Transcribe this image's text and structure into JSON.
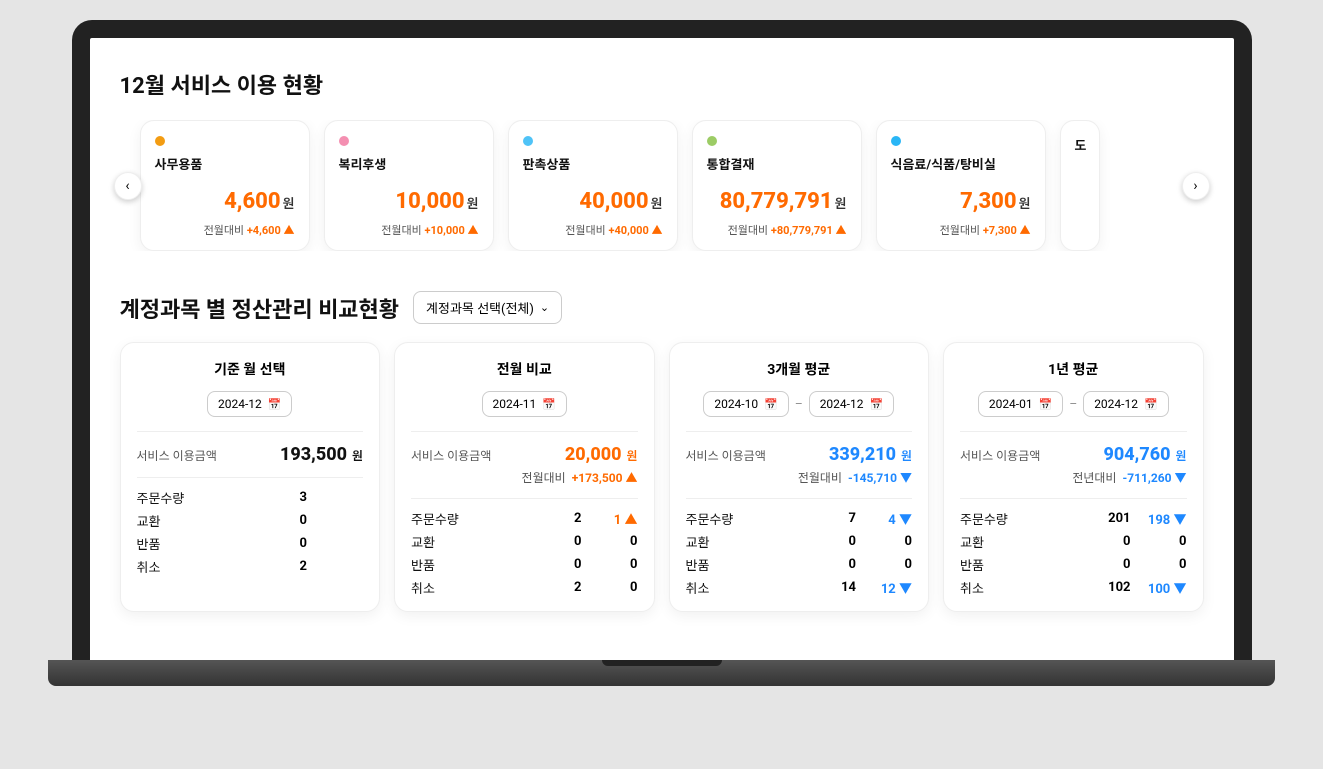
{
  "section1": {
    "title": "12월 서비스 이용 현황",
    "cards": [
      {
        "dot": "#f39c12",
        "name": "사무용품",
        "amount": "4,600",
        "won": "원",
        "delta_label": "전월대비",
        "delta": "+4,600"
      },
      {
        "dot": "#f48fb1",
        "name": "복리후생",
        "amount": "10,000",
        "won": "원",
        "delta_label": "전월대비",
        "delta": "+10,000"
      },
      {
        "dot": "#4fc3f7",
        "name": "판촉상품",
        "amount": "40,000",
        "won": "원",
        "delta_label": "전월대비",
        "delta": "+40,000"
      },
      {
        "dot": "#9ccc65",
        "name": "통합결재",
        "amount": "80,779,791",
        "won": "원",
        "delta_label": "전월대비",
        "delta": "+80,779,791"
      },
      {
        "dot": "#29b6f6",
        "name": "식음료/식품/탕비실",
        "amount": "7,300",
        "won": "원",
        "delta_label": "전월대비",
        "delta": "+7,300"
      }
    ],
    "peek_name": "도"
  },
  "section2": {
    "title": "계정과목 별 정산관리 비교현황",
    "select_label": "계정과목 선택(전체)",
    "cards": [
      {
        "title": "기준 월 선택",
        "dates": [
          "2024-12"
        ],
        "amount_label": "서비스 이용금액",
        "amount": "193,500",
        "won": "원",
        "amount_color": "black",
        "delta": null,
        "stats": [
          {
            "k": "주문수량",
            "v1": "3",
            "v2": null
          },
          {
            "k": "교환",
            "v1": "0",
            "v2": null
          },
          {
            "k": "반품",
            "v1": "0",
            "v2": null
          },
          {
            "k": "취소",
            "v1": "2",
            "v2": null
          }
        ]
      },
      {
        "title": "전월 비교",
        "dates": [
          "2024-11"
        ],
        "amount_label": "서비스 이용금액",
        "amount": "20,000",
        "won": "원",
        "amount_color": "orange",
        "delta": {
          "label": "전월대비",
          "value": "+173,500",
          "dir": "up",
          "color": "orange"
        },
        "stats": [
          {
            "k": "주문수량",
            "v1": "2",
            "v2": "1",
            "dir": "up",
            "color": "orange"
          },
          {
            "k": "교환",
            "v1": "0",
            "v2": "0"
          },
          {
            "k": "반품",
            "v1": "0",
            "v2": "0"
          },
          {
            "k": "취소",
            "v1": "2",
            "v2": "0"
          }
        ]
      },
      {
        "title": "3개월 평균",
        "dates": [
          "2024-10",
          "2024-12"
        ],
        "amount_label": "서비스 이용금액",
        "amount": "339,210",
        "won": "원",
        "amount_color": "blue",
        "delta": {
          "label": "전월대비",
          "value": "-145,710",
          "dir": "down",
          "color": "blue"
        },
        "stats": [
          {
            "k": "주문수량",
            "v1": "7",
            "v2": "4",
            "dir": "down",
            "color": "blue"
          },
          {
            "k": "교환",
            "v1": "0",
            "v2": "0"
          },
          {
            "k": "반품",
            "v1": "0",
            "v2": "0"
          },
          {
            "k": "취소",
            "v1": "14",
            "v2": "12",
            "dir": "down",
            "color": "blue"
          }
        ]
      },
      {
        "title": "1년 평균",
        "dates": [
          "2024-01",
          "2024-12"
        ],
        "amount_label": "서비스 이용금액",
        "amount": "904,760",
        "won": "원",
        "amount_color": "blue",
        "delta": {
          "label": "전년대비",
          "value": "-711,260",
          "dir": "down",
          "color": "blue"
        },
        "stats": [
          {
            "k": "주문수량",
            "v1": "201",
            "v2": "198",
            "dir": "down",
            "color": "blue"
          },
          {
            "k": "교환",
            "v1": "0",
            "v2": "0"
          },
          {
            "k": "반품",
            "v1": "0",
            "v2": "0"
          },
          {
            "k": "취소",
            "v1": "102",
            "v2": "100",
            "dir": "down",
            "color": "blue"
          }
        ]
      }
    ]
  }
}
